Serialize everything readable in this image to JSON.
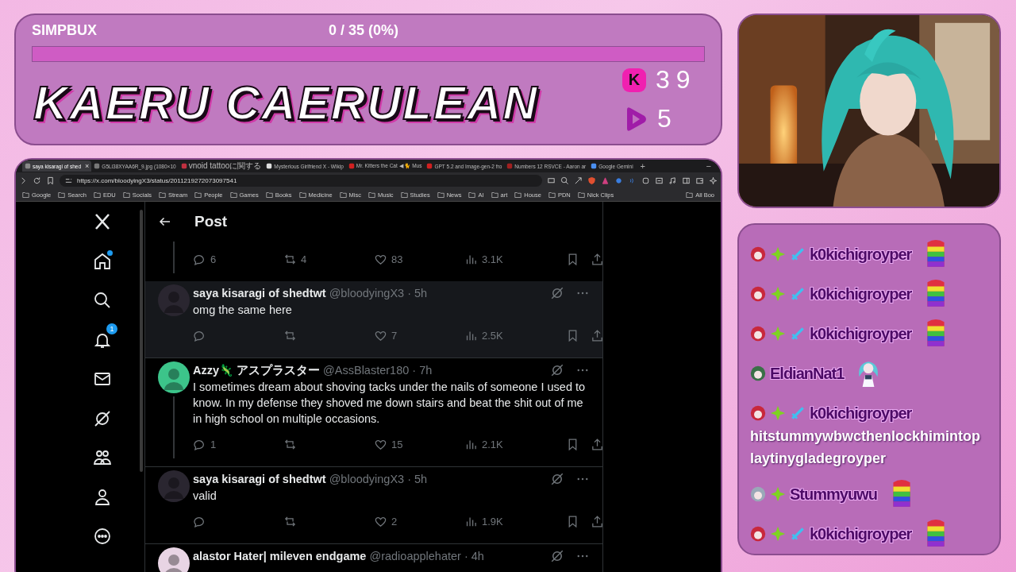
{
  "goal": {
    "label": "SIMPBUX",
    "progress": "0 / 35 (0%)",
    "level": 0
  },
  "channel": {
    "title": "KAERU CAERULEAN",
    "stats": [
      {
        "kind": "letter",
        "icon": "K",
        "count": "39"
      },
      {
        "kind": "play",
        "count": "5"
      }
    ]
  },
  "browser": {
    "tabs": [
      {
        "title": "saya kisaragi of shed",
        "close": "×",
        "selected": true
      },
      {
        "title": "G5Li38XYAA6R_9.jpg (1080×10",
        "selected": false
      },
      {
        "title": "vnoid tattooに関する",
        "selected": false
      },
      {
        "title": "Mysterious Girlfriend X - Wikip",
        "selected": false
      },
      {
        "title": "Mr. Kitters the Cat ◀ 🐈 Mus",
        "selected": false
      },
      {
        "title": "GPT 5.2 and Image-gen-2 fro",
        "selected": false
      },
      {
        "title": "Numbers 12 RSVCE - Aaron ar",
        "selected": false
      },
      {
        "title": "Google Gemini",
        "selected": false
      }
    ],
    "new_tab": "+",
    "minimize": "−",
    "url": "https://x.com/bloodyingX3/status/2011219272073097541",
    "bookmarks": [
      "Google",
      "Search",
      "EDU",
      "Socials",
      "Stream",
      "People",
      "Games",
      "Books",
      "Medicine",
      "Misc",
      "Music",
      "Studies",
      "News",
      "AI",
      "art",
      "House",
      "PDN",
      "Nick Clips"
    ],
    "all_bookmarks": "All Boo"
  },
  "nav": [
    {
      "kind": "logo"
    },
    {
      "kind": "home",
      "dot": true
    },
    {
      "kind": "search"
    },
    {
      "kind": "notifications",
      "badge": "1"
    },
    {
      "kind": "messages"
    },
    {
      "kind": "grok"
    },
    {
      "kind": "communities"
    },
    {
      "kind": "profile"
    },
    {
      "kind": "more"
    }
  ],
  "page": {
    "title": "Post"
  },
  "posts": [
    {
      "kind": "actions_only",
      "thread": true,
      "highlighted": false,
      "stats": {
        "replies": "6",
        "retweets": "4",
        "likes": "83",
        "views": "3.1K"
      }
    },
    {
      "kind": "post",
      "thread": false,
      "highlighted": true,
      "color": "#2a2630",
      "author": "saya kisaragi of shedtwt",
      "meta": "@bloodyingX3 · 5h",
      "text": "omg the same here",
      "stats": {
        "likes": "7",
        "views": "2.5K"
      }
    },
    {
      "kind": "post",
      "thread": true,
      "highlighted": false,
      "color": "#3cc48a",
      "author": "Azzy🦎 アスプラスター",
      "meta": "@AssBlaster180 · 7h",
      "text": "I sometimes dream about shoving tacks under the nails of someone I used to know. In my defense they shoved me down stairs and beat the shit out of me in high school on multiple occasions.",
      "stats": {
        "replies": "1",
        "likes": "15",
        "views": "2.1K"
      }
    },
    {
      "kind": "post",
      "thread": false,
      "highlighted": false,
      "color": "#2a2630",
      "author": "saya kisaragi of shedtwt",
      "meta": "@bloodyingX3 · 5h",
      "text": "valid",
      "stats": {
        "likes": "2",
        "views": "1.9K"
      }
    },
    {
      "kind": "post",
      "thread": false,
      "highlighted": false,
      "color": "#e8d4e4",
      "author": "alastor Hater| mileven endgame",
      "meta": "@radioapplehater · 4h"
    }
  ],
  "chat": [
    {
      "kind": "rainbow",
      "user": "k0kichigroyper",
      "badges": [
        {
          "kind": "avatar",
          "color": "#c8283c"
        },
        {
          "kind": "gem"
        },
        {
          "kind": "sword"
        }
      ]
    },
    {
      "kind": "rainbow",
      "user": "k0kichigroyper",
      "badges": [
        {
          "kind": "avatar",
          "color": "#c8283c"
        },
        {
          "kind": "gem"
        },
        {
          "kind": "sword"
        }
      ]
    },
    {
      "kind": "rainbow",
      "user": "k0kichigroyper",
      "badges": [
        {
          "kind": "avatar",
          "color": "#c8283c"
        },
        {
          "kind": "gem"
        },
        {
          "kind": "sword"
        }
      ]
    },
    {
      "kind": "figure",
      "user": "EldianNat1",
      "badges": [
        {
          "kind": "avatar",
          "color": "#3a7048"
        }
      ]
    },
    {
      "kind": "text",
      "user": "k0kichigroyper",
      "badges": [
        {
          "kind": "avatar",
          "color": "#c8283c"
        },
        {
          "kind": "gem"
        },
        {
          "kind": "sword"
        }
      ],
      "text": "hitstummywbwcthenlockhimintoplaytinygladegroyper"
    },
    {
      "kind": "rainbow",
      "user": "Stummyuwu",
      "badges": [
        {
          "kind": "avatar",
          "color": "#9aa8b8"
        },
        {
          "kind": "gem"
        }
      ]
    },
    {
      "kind": "rainbow",
      "user": "k0kichigroyper",
      "badges": [
        {
          "kind": "avatar",
          "color": "#c8283c"
        },
        {
          "kind": "gem"
        },
        {
          "kind": "sword"
        }
      ]
    }
  ]
}
